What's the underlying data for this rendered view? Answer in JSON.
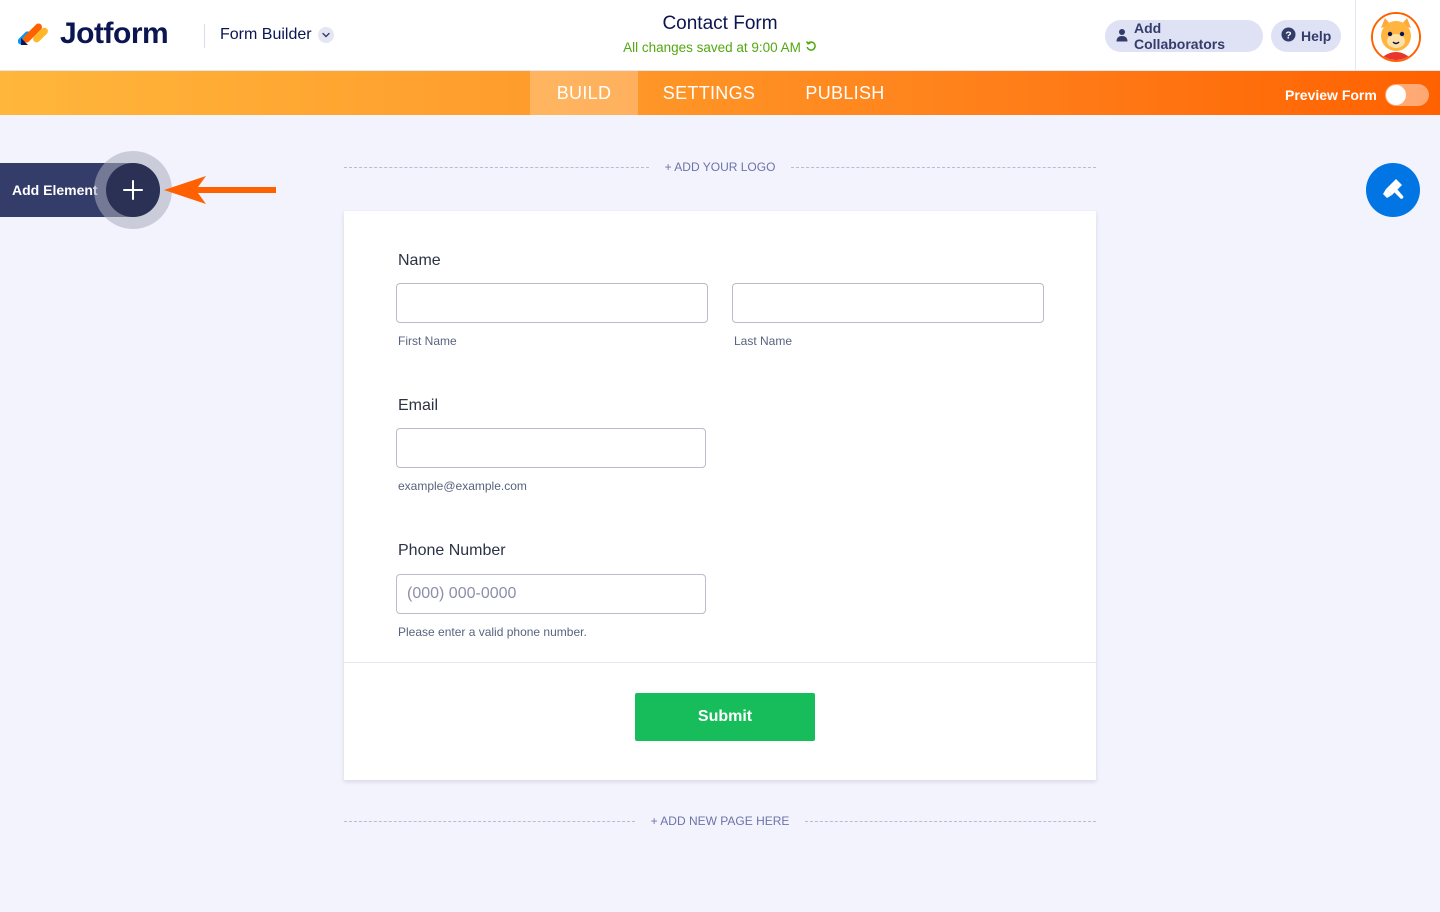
{
  "header": {
    "brand": "Jotform",
    "builder_menu_label": "Form Builder",
    "form_title": "Contact Form",
    "save_status": "All changes saved at 9:00 AM",
    "collaborators_label": "Add Collaborators",
    "help_label": "Help"
  },
  "nav": {
    "tabs": [
      {
        "label": "BUILD",
        "active": true
      },
      {
        "label": "SETTINGS",
        "active": false
      },
      {
        "label": "PUBLISH",
        "active": false
      }
    ],
    "preview_label": "Preview Form",
    "preview_enabled": false
  },
  "sidebar": {
    "add_element_label": "Add Element"
  },
  "canvas": {
    "add_logo_label": "+ ADD YOUR LOGO",
    "add_page_label": "+ ADD NEW PAGE HERE"
  },
  "form": {
    "name": {
      "label": "Name",
      "first_sublabel": "First Name",
      "last_sublabel": "Last Name"
    },
    "email": {
      "label": "Email",
      "sublabel": "example@example.com"
    },
    "phone": {
      "label": "Phone Number",
      "placeholder": "(000) 000-0000",
      "sublabel": "Please enter a valid phone number."
    },
    "submit_label": "Submit"
  },
  "colors": {
    "brand_navy": "#0a1551",
    "nav_orange_start": "#ffb63b",
    "nav_orange_end": "#ff6100",
    "submit_green": "#18bd5b",
    "designer_blue": "#0075e3",
    "saved_green": "#53a811"
  },
  "icons": [
    "jotform-logo-icon",
    "chevron-down-icon",
    "refresh-icon",
    "user-icon",
    "help-icon",
    "avatar-icon",
    "plus-icon",
    "arrow-left-icon",
    "paint-brush-icon"
  ]
}
